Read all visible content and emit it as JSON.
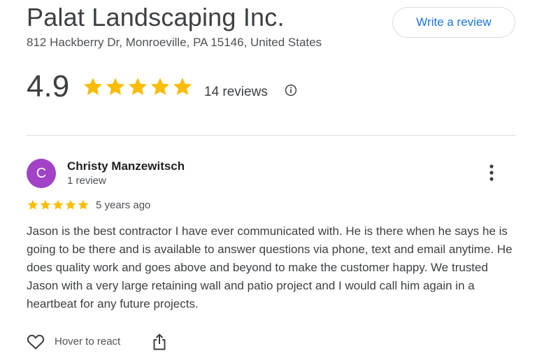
{
  "business": {
    "name": "Palat Landscaping Inc.",
    "address": "812 Hackberry Dr, Monroeville, PA 15146, United States"
  },
  "actions": {
    "write_review_label": "Write a review"
  },
  "summary": {
    "rating": "4.9",
    "stars": 5,
    "reviews_label": "14 reviews",
    "info_icon": "info-icon"
  },
  "review": {
    "avatar_initial": "C",
    "reviewer_name": "Christy Manzewitsch",
    "reviewer_review_count": "1 review",
    "stars": 5,
    "time": "5 years ago",
    "text": "Jason is the best contractor I have ever communicated with. He is there when he says he is going to be there and is available to answer questions via phone, text and email anytime. He does quality work and goes above and beyond to make the customer happy. We trusted Jason with a very large retaining wall and patio project and I would call him again in a heartbeat for any future projects.",
    "react_label": "Hover to react",
    "more_icon": "more-vert-icon",
    "share_icon": "share-icon",
    "heart_icon": "heart-outline-icon"
  },
  "colors": {
    "star": "#fbbc04",
    "link_blue": "#1a73e8",
    "avatar_bg": "#a142c7"
  }
}
